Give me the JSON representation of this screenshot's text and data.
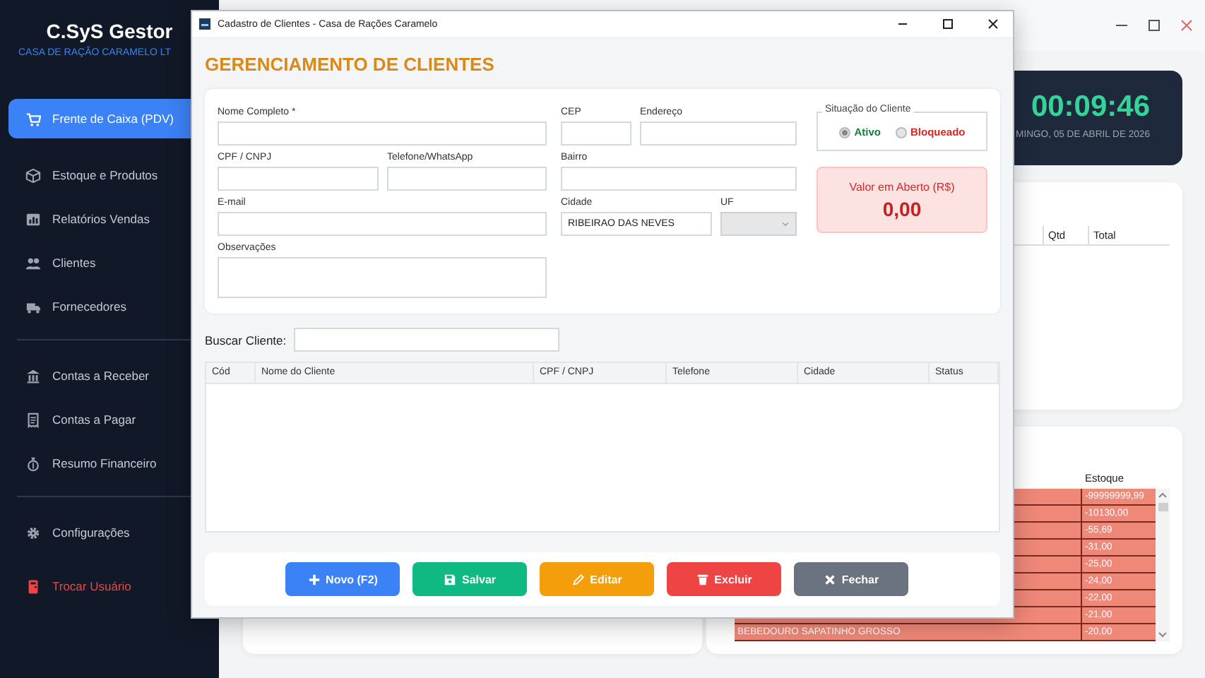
{
  "sidebar": {
    "logo": "C.SyS Gestor",
    "company": "CASA DE RAÇÃO CARAMELO LT",
    "nav_groups": [
      {
        "items": [
          {
            "label": "Frente de Caixa (PDV)",
            "selected": true
          },
          {
            "label": "Estoque e Produtos",
            "selected": false
          },
          {
            "label": "Relatórios Vendas",
            "selected": false
          },
          {
            "label": "Clientes",
            "selected": false
          },
          {
            "label": "Fornecedores",
            "selected": false
          }
        ]
      },
      {
        "items": [
          {
            "label": "Contas a Receber",
            "selected": false
          },
          {
            "label": "Contas a Pagar",
            "selected": false
          },
          {
            "label": "Resumo Financeiro",
            "selected": false
          }
        ]
      },
      {
        "items": [
          {
            "label": "Configurações",
            "selected": false
          }
        ]
      }
    ],
    "logout": {
      "label": "Trocar Usuário"
    }
  },
  "main_window": {
    "clock": {
      "time": "00:09:46",
      "date": "MINGO, 05 DE ABRIL DE 2026"
    },
    "sales_table": {
      "columns": [
        "Qtd",
        "Total"
      ]
    },
    "stock_table": {
      "column": "Estoque",
      "rows": [
        {
          "stock": "-99999999,99"
        },
        {
          "stock": "-10130,00"
        },
        {
          "stock": "-55,69"
        },
        {
          "stock": "-31,00"
        },
        {
          "stock": "-25,00"
        },
        {
          "stock": "-24,00"
        },
        {
          "stock": "-22,00"
        },
        {
          "stock": "-21,00"
        },
        {
          "name": "BEBEDOURO SAPATINHO GROSSO",
          "stock": "-20,00"
        }
      ]
    }
  },
  "dialog": {
    "title": "Cadastro de Clientes - Casa de Rações Caramelo",
    "heading": "GERENCIAMENTO DE CLIENTES",
    "fields": [
      {
        "label": "Nome Completo *",
        "kind": "text",
        "disabled": false
      },
      {
        "label": "CEP",
        "kind": "text",
        "disabled": false
      },
      {
        "label": "Endereço",
        "kind": "text",
        "disabled": false
      },
      {
        "label": "CPF / CNPJ",
        "kind": "text",
        "disabled": false
      },
      {
        "label": "Telefone/WhatsApp",
        "kind": "text",
        "disabled": false
      },
      {
        "label": "Bairro",
        "kind": "text",
        "disabled": false
      },
      {
        "label": "E-mail",
        "kind": "text",
        "disabled": false
      },
      {
        "label": "Cidade",
        "kind": "text",
        "value": "RIBEIRAO DAS NEVES",
        "disabled": false
      },
      {
        "label": "UF",
        "kind": "select",
        "disabled": true
      },
      {
        "label": "Observações",
        "kind": "textarea",
        "disabled": false
      }
    ],
    "status": {
      "legend": "Situação do Cliente",
      "options": [
        {
          "label": "Ativo",
          "selected": true,
          "color": "#15803d"
        },
        {
          "label": "Bloqueado",
          "selected": false,
          "color": "#dc2626"
        }
      ]
    },
    "balance": {
      "label": "Valor em Aberto (R$)",
      "value": "0,00"
    },
    "search": {
      "label": "Buscar Cliente:"
    },
    "table": {
      "columns": [
        "Cód",
        "Nome do Cliente",
        "CPF / CNPJ",
        "Telefone",
        "Cidade",
        "Status"
      ]
    },
    "buttons": [
      {
        "label": "Novo (F2)",
        "kind": "new"
      },
      {
        "label": "Salvar",
        "kind": "save"
      },
      {
        "label": "Editar",
        "kind": "edit"
      },
      {
        "label": "Excluir",
        "kind": "delete"
      },
      {
        "label": "Fechar",
        "kind": "close"
      }
    ]
  }
}
